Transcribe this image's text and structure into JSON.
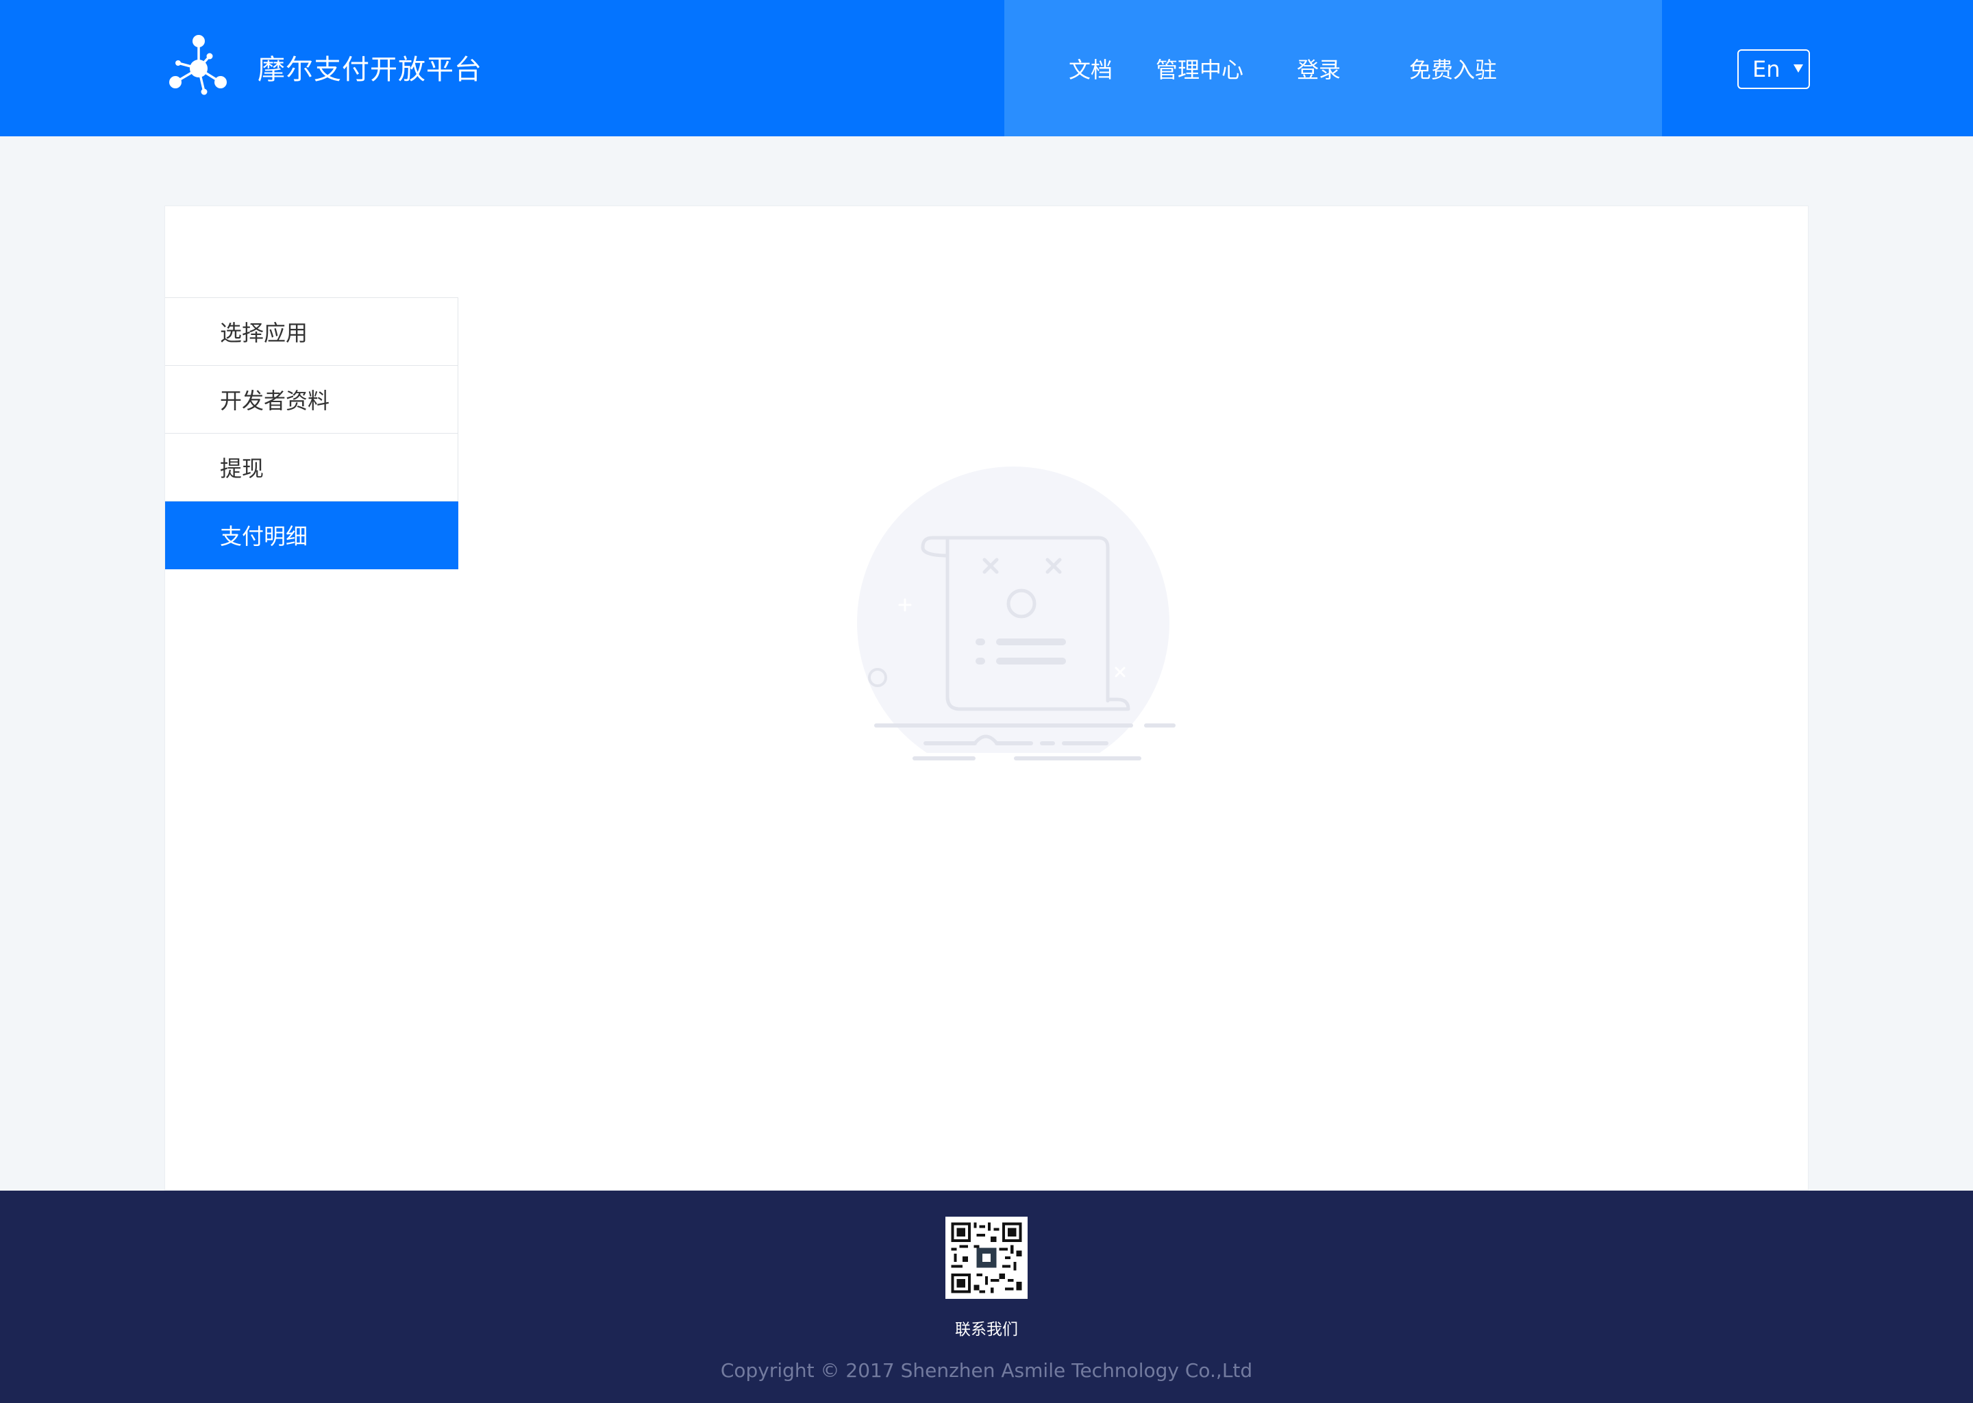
{
  "header": {
    "brand_title": "摩尔支付开放平台",
    "nav": {
      "docs": "文档",
      "management_center": "管理中心",
      "login": "登录",
      "free_register": "免费入驻"
    },
    "language": {
      "selected": "En"
    }
  },
  "sidebar": {
    "items": [
      {
        "label": "选择应用",
        "active": false
      },
      {
        "label": "开发者资料",
        "active": false
      },
      {
        "label": "提现",
        "active": false
      },
      {
        "label": "支付明细",
        "active": true
      }
    ]
  },
  "main": {
    "empty_state_icon": "empty-document-icon"
  },
  "footer": {
    "qr_icon": "qr-code-icon",
    "contact_label": "联系我们",
    "copyright": "Copyright © 2017 Shenzhen Asmile Technology Co.,Ltd"
  },
  "colors": {
    "primary": "#0474ff",
    "nav_highlight": "#2a8efe",
    "page_background": "#f3f6f9",
    "footer_background": "#1c2553",
    "footer_text_muted": "#737b9f"
  }
}
